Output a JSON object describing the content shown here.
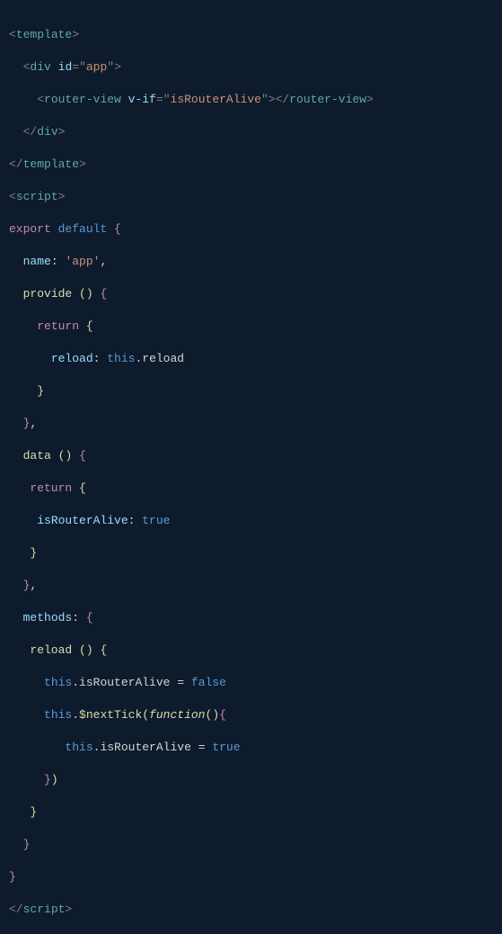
{
  "code": {
    "l1": {
      "lt": "<",
      "tag": "template",
      "gt": ">"
    },
    "l2": {
      "pad": "  ",
      "lt": "<",
      "tag": "div",
      "sp": " ",
      "attr": "id",
      "eq": "=",
      "q1": "\"",
      "val": "app",
      "q2": "\"",
      "gt": ">"
    },
    "l3": {
      "pad": "    ",
      "lt": "<",
      "tag": "router-view",
      "sp": " ",
      "attr": "v-if",
      "eq": "=",
      "q1": "\"",
      "val": "isRouterAlive",
      "q2": "\"",
      "gt": ">",
      "lt2": "</",
      "tag2": "router-view",
      "gt2": ">"
    },
    "l4": {
      "pad": "  ",
      "lt": "</",
      "tag": "div",
      "gt": ">"
    },
    "l5": {
      "lt": "</",
      "tag": "template",
      "gt": ">"
    },
    "l6": {
      "lt": "<",
      "tag": "script",
      "gt": ">"
    },
    "l7": {
      "export": "export",
      "sp": " ",
      "default": "default",
      "sp2": " ",
      "brace": "{"
    },
    "l8": {
      "pad": "  ",
      "name": "name",
      "colon": ": ",
      "q": "'",
      "val": "app",
      "q2": "'",
      "comma": ","
    },
    "l9": {
      "pad": "  ",
      "ident": "provide",
      "sp": " ",
      "p1": "(",
      "p2": ")",
      "sp2": " ",
      "brace": "{"
    },
    "l10": {
      "pad": "    ",
      "ret": "return",
      "sp": " ",
      "brace": "{"
    },
    "l11": {
      "pad": "      ",
      "key": "reload",
      "colon": ": ",
      "this": "this",
      "dot": ".",
      "prop": "reload"
    },
    "l12": {
      "pad": "    ",
      "brace": "}"
    },
    "l13": {
      "pad": "  ",
      "brace": "}",
      "comma": ","
    },
    "l14": {
      "pad": "  ",
      "ident": "data",
      "sp": " ",
      "p1": "(",
      "p2": ")",
      "sp2": " ",
      "brace": "{"
    },
    "l15": {
      "pad": "   ",
      "ret": "return",
      "sp": " ",
      "brace": "{"
    },
    "l16": {
      "pad": "    ",
      "key": "isRouterAlive",
      "colon": ": ",
      "bool": "true"
    },
    "l17": {
      "pad": "   ",
      "brace": "}"
    },
    "l18": {
      "pad": "  ",
      "brace": "}",
      "comma": ","
    },
    "l19": {
      "pad": "  ",
      "key": "methods",
      "colon": ": ",
      "brace": "{"
    },
    "l20": {
      "pad": "   ",
      "ident": "reload",
      "sp": " ",
      "p1": "(",
      "p2": ")",
      "sp2": " ",
      "brace": "{"
    },
    "l21": {
      "pad": "     ",
      "this": "this",
      "dot": ".",
      "prop": "isRouterAlive",
      "sp": " ",
      "eq": "=",
      "sp2": " ",
      "bool": "false"
    },
    "l22": {
      "pad": "     ",
      "this": "this",
      "dot": ".",
      "method": "$nextTick",
      "p1": "(",
      "func": "function",
      "p2": "(",
      "p3": ")",
      "brace": "{"
    },
    "l23": {
      "pad": "        ",
      "this": "this",
      "dot": ".",
      "prop": "isRouterAlive",
      "sp": " ",
      "eq": "=",
      "sp2": " ",
      "bool": "true"
    },
    "l24": {
      "pad": "     ",
      "brace": "}",
      "p1": ")"
    },
    "l25": {
      "pad": "   ",
      "brace": "}"
    },
    "l26": {
      "pad": "  ",
      "brace": "}"
    },
    "l27": {
      "brace": "}"
    },
    "l28": {
      "lt": "</",
      "tag": "script",
      "gt": ">"
    }
  }
}
